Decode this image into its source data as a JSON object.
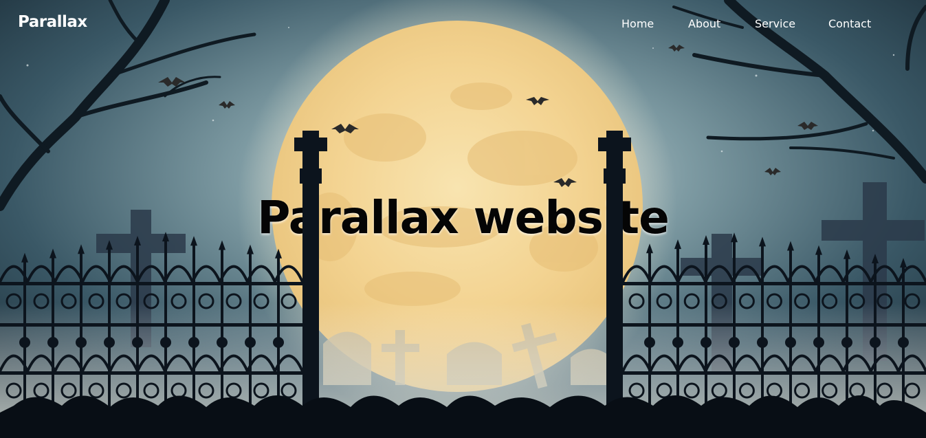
{
  "header": {
    "logo": "Parallax",
    "nav": [
      {
        "label": "Home"
      },
      {
        "label": "About"
      },
      {
        "label": "Service"
      },
      {
        "label": "Contact"
      }
    ]
  },
  "hero": {
    "title": "Parallax website"
  },
  "colors": {
    "sky": "#27404d",
    "moon": "#f3d79a",
    "silhouette": "#0d1620",
    "text": "#ffffff",
    "title": "#050505"
  }
}
